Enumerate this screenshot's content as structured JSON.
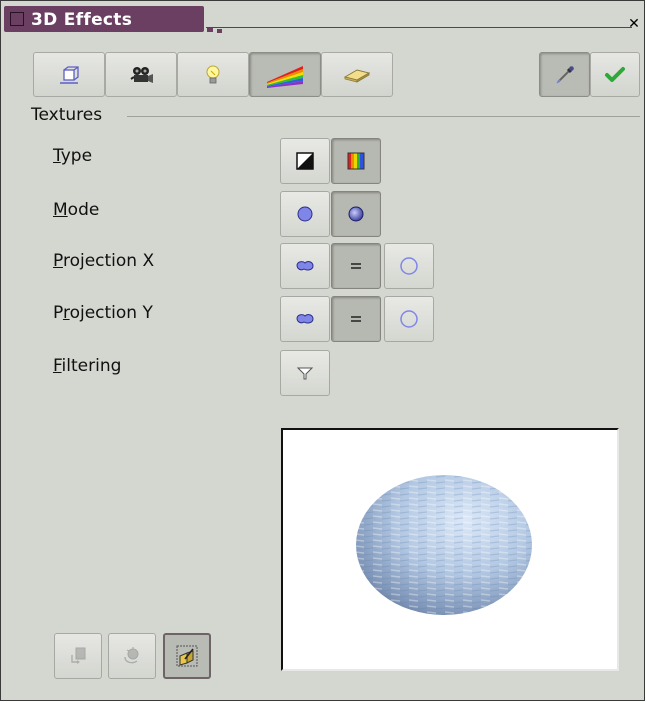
{
  "window": {
    "title": "3D Effects",
    "close_symbol": "✕"
  },
  "toolbar": {
    "left_buttons": [
      {
        "name": "geometry",
        "icon": "geometry-cube-icon"
      },
      {
        "name": "shading",
        "icon": "camera-icon"
      },
      {
        "name": "illumination",
        "icon": "lightbulb-icon"
      },
      {
        "name": "textures",
        "icon": "rainbow-texture-icon",
        "selected": true
      },
      {
        "name": "material",
        "icon": "material-bar-icon"
      }
    ],
    "right_buttons": [
      {
        "name": "assign-pipette",
        "icon": "pipette-icon",
        "selected": true
      },
      {
        "name": "apply",
        "icon": "checkmark-icon"
      }
    ]
  },
  "textures": {
    "section_title": "Textures",
    "type": {
      "label_pre": "",
      "label_u": "T",
      "label_post": "ype",
      "options": [
        "black-white",
        "color"
      ],
      "selected": 1
    },
    "mode": {
      "label_pre": "",
      "label_u": "M",
      "label_post": "ode",
      "options": [
        "only-texture",
        "texture-and-shading"
      ],
      "selected": 1
    },
    "projection_x": {
      "label_pre": "",
      "label_u": "P",
      "label_post": "rojection X",
      "options": [
        "object-specific",
        "parallel",
        "circular"
      ],
      "selected": 1
    },
    "projection_y": {
      "label_pre": "P",
      "label_u": "r",
      "label_post": "ojection Y",
      "options": [
        "object-specific",
        "parallel",
        "circular"
      ],
      "selected": 1
    },
    "filtering": {
      "label_pre": "",
      "label_u": "F",
      "label_post": "iltering",
      "options": [
        "filter-toggle"
      ],
      "selected": -1
    }
  },
  "bottom_buttons": [
    {
      "name": "convert-to-3d",
      "icon": "convert-3d-icon",
      "enabled": false
    },
    {
      "name": "convert-to-lathe",
      "icon": "lathe-object-icon",
      "enabled": false
    },
    {
      "name": "perspective",
      "icon": "perspective-icon",
      "selected": true
    }
  ],
  "colors": {
    "title_accent": "#6b3f62",
    "dialog_bg": "#d4d6d0",
    "sphere_blue": "#8ea9cf",
    "option_icon_blue": "#7f86e8"
  }
}
